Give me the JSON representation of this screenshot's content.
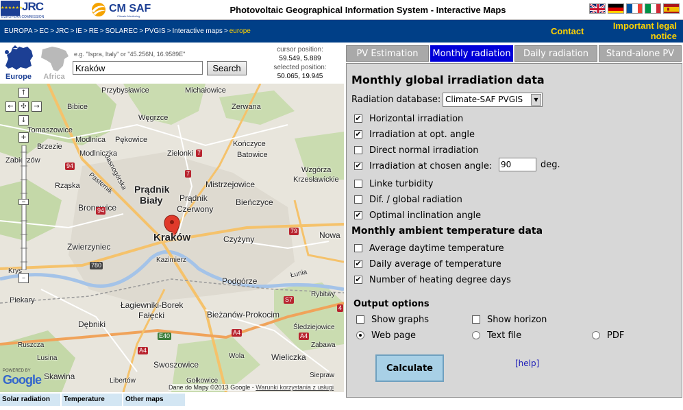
{
  "header": {
    "jrc_label": "JRC",
    "jrc_sub": "EUROPEAN COMMISSION",
    "cmsaf_label": "CM SAF",
    "cmsaf_sub": "Climate Monitoring",
    "title": "Photovoltaic Geographical Information System - Interactive Maps",
    "flags": [
      "gb-flag-icon",
      "de-flag-icon",
      "fr-flag-icon",
      "it-flag-icon",
      "es-flag-icon"
    ]
  },
  "nav": {
    "breadcrumb": [
      "EUROPA",
      "EC",
      "JRC",
      "IE",
      "RE",
      "SOLAREC",
      "PVGIS",
      "Interactive maps"
    ],
    "breadcrumb_current": "europe",
    "separator": ">",
    "contact": "Contact",
    "legal": "Important legal notice"
  },
  "search": {
    "europe_label": "Europe",
    "africa_label": "Africa",
    "hint": "e.g. \"Ispra, Italy\" or \"45.256N, 16.9589E\"",
    "value": "Kraków",
    "button": "Search",
    "cursor_label": "cursor position:",
    "cursor_value": "59.549, 5.889",
    "selected_label": "selected position:",
    "selected_value": "50.065, 19.945"
  },
  "map": {
    "labels": {
      "przybyslawice": "Przybysławice",
      "michalowice": "Michałowice",
      "bibice": "Bibice",
      "zerwana": "Zerwana",
      "wegrzce": "Węgrzce",
      "tomaszowice": "Tomaszowice",
      "modlnica": "Modlnica",
      "pekowice": "Pękowice",
      "koncyce": "Kończyce",
      "brzezie": "Brzezie",
      "modlniczka": "Modlniczka",
      "zielonki": "Zielonki",
      "batowice": "Batowice",
      "zabierzow": "Zabierzów",
      "wzgorza": "Wzgórza",
      "krzeslawickie": "Krzesławickie",
      "jasnogorska": "Jasnogórska",
      "pasternik": "Pasternik",
      "rzaska": "Rząska",
      "pradnik_bialy_1": "Prądnik",
      "pradnik_bialy_2": "Biały",
      "pradnik_czerwony_1": "Prądnik",
      "pradnik_czerwony_2": "Czerwony",
      "mistrzejowice": "Mistrzejowice",
      "bronowice": "Bronowice",
      "bienczyce": "Bieńczyce",
      "krakow": "Kraków",
      "nowa": "Nowa",
      "czyzyny": "Czyżyny",
      "zwierzyniec": "Zwierzyniec",
      "kazimierz": "Kazimierz",
      "krys": "Krys",
      "podgorze": "Podgórze",
      "piekary": "Piekary",
      "lagiewniki": "Łagiewniki-Borek",
      "falecki": "Fałęcki",
      "biezanow": "Bieżanów-Prokocim",
      "debniki": "Dębniki",
      "sledziejowice": "Śledziejowice",
      "swoszowice": "Swoszowice",
      "wieliczka": "Wieliczka",
      "skawina": "Skawina",
      "libertow": "Libertów",
      "golkowice": "Gołkowice",
      "lusina": "Lusina",
      "ruszcza": "Ruszcza",
      "rybitwy": "Rybitwy",
      "wola": "Wola",
      "siepraw": "Siepraw",
      "zabawa": "Zabawa",
      "lunia": "Łunia"
    },
    "roads": {
      "r94a": "94",
      "r94b": "94",
      "r7a": "7",
      "r7b": "7",
      "r79": "79",
      "r780": "780",
      "s7": "S7",
      "a4a": "A4",
      "a4b": "A4",
      "a4c": "A4",
      "e40": "E40",
      "r4": "4"
    },
    "attribution": "Dane do Mapy ©2013 Google -",
    "terms": "Warunki korzystania z usługi",
    "google_powered": "POWERED BY",
    "google": "Google"
  },
  "map_tabs": [
    "Solar radiation",
    "Temperature",
    "Other maps"
  ],
  "tabs": [
    "PV Estimation",
    "Monthly radiation",
    "Daily radiation",
    "Stand-alone PV"
  ],
  "active_tab": "Monthly radiation",
  "form": {
    "title": "Monthly global irradiation data",
    "db_label": "Radiation database:",
    "db_value": "Climate-SAF PVGIS",
    "irradiation_options": [
      {
        "label": "Horizontal irradiation",
        "checked": true
      },
      {
        "label": "Irradiation at opt. angle",
        "checked": true
      },
      {
        "label": "Direct normal irradiation",
        "checked": false
      },
      {
        "label": "Irradiation at chosen angle:",
        "checked": true
      },
      {
        "label": "Linke turbidity",
        "checked": false
      },
      {
        "label": "Dif. / global radiation",
        "checked": false
      },
      {
        "label": "Optimal inclination angle",
        "checked": true
      }
    ],
    "angle_value": "90",
    "angle_unit": "deg.",
    "temp_title": "Monthly ambient temperature data",
    "temp_options": [
      {
        "label": "Average daytime temperature",
        "checked": false
      },
      {
        "label": "Daily average of temperature",
        "checked": true
      },
      {
        "label": "Number of heating degree days",
        "checked": true
      }
    ],
    "output_title": "Output options",
    "output_checks": [
      {
        "label": "Show graphs",
        "checked": false
      },
      {
        "label": "Show horizon",
        "checked": false
      }
    ],
    "output_formats": [
      {
        "label": "Web page",
        "selected": true
      },
      {
        "label": "Text file",
        "selected": false
      },
      {
        "label": "PDF",
        "selected": false
      }
    ],
    "calculate": "Calculate",
    "help": "[help]"
  },
  "colors": {
    "nav_bg": "#003f87",
    "nav_link": "#ffd300",
    "tab_active": "#0000d8",
    "tab_inactive": "#a9a9a9",
    "form_bg": "#d7d7d7",
    "calc_button": "#a8d0e6"
  }
}
